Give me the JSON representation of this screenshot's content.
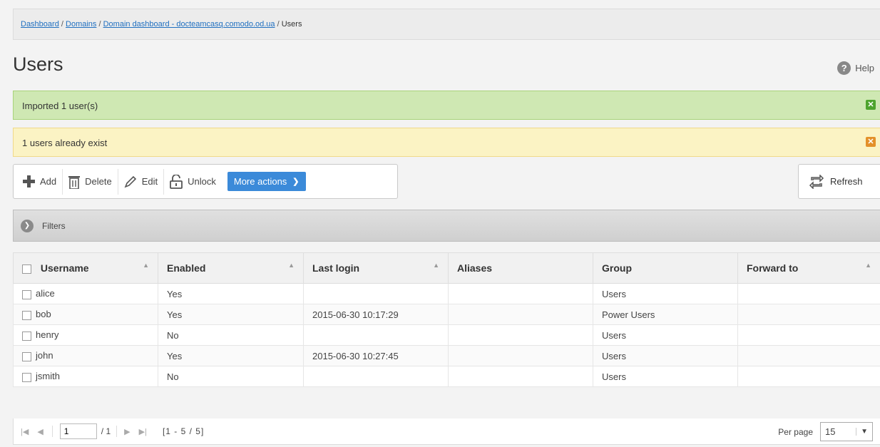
{
  "breadcrumb": {
    "items": [
      "Dashboard",
      "Domains",
      "Domain dashboard - docteamcasq.comodo.od.ua"
    ],
    "current": "Users"
  },
  "page": {
    "title": "Users",
    "help_label": "Help"
  },
  "alerts": {
    "success": "Imported 1 user(s)",
    "warning": "1 users already exist"
  },
  "toolbar": {
    "add": "Add",
    "delete": "Delete",
    "edit": "Edit",
    "unlock": "Unlock",
    "more_actions": "More actions",
    "refresh": "Refresh"
  },
  "filters": {
    "label": "Filters"
  },
  "table": {
    "columns": [
      "Username",
      "Enabled",
      "Last login",
      "Aliases",
      "Group",
      "Forward to"
    ],
    "rows": [
      {
        "username": "alice",
        "enabled": "Yes",
        "last_login": "",
        "aliases": "",
        "group": "Users",
        "forward_to": ""
      },
      {
        "username": "bob",
        "enabled": "Yes",
        "last_login": "2015-06-30 10:17:29",
        "aliases": "",
        "group": "Power Users",
        "forward_to": ""
      },
      {
        "username": "henry",
        "enabled": "No",
        "last_login": "",
        "aliases": "",
        "group": "Users",
        "forward_to": ""
      },
      {
        "username": "john",
        "enabled": "Yes",
        "last_login": "2015-06-30 10:27:45",
        "aliases": "",
        "group": "Users",
        "forward_to": ""
      },
      {
        "username": "jsmith",
        "enabled": "No",
        "last_login": "",
        "aliases": "",
        "group": "Users",
        "forward_to": ""
      }
    ]
  },
  "pager": {
    "page": "1",
    "of": "/ 1",
    "range": "[1 - 5 / 5]",
    "per_page_label": "Per page",
    "per_page": "15"
  },
  "colors": {
    "accent": "#3b8ad9",
    "success_bg": "#cfe8b3",
    "warning_bg": "#fbf3c4",
    "link": "#1f6fc0"
  }
}
